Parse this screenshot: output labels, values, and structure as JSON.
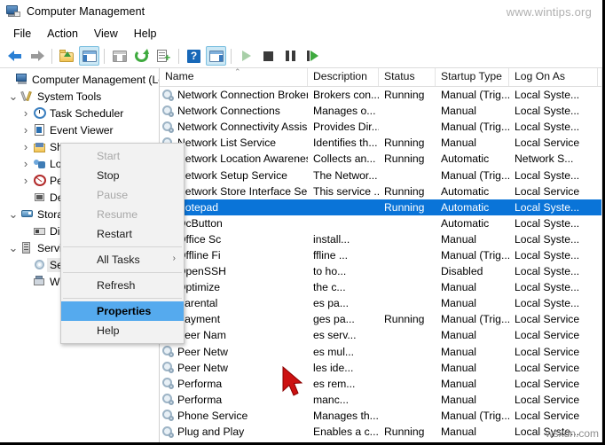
{
  "window": {
    "title": "Computer Management",
    "icon": "computer-management-icon"
  },
  "menubar": {
    "items": [
      {
        "label": "File"
      },
      {
        "label": "Action"
      },
      {
        "label": "View"
      },
      {
        "label": "Help"
      }
    ]
  },
  "toolbar": {
    "buttons": [
      {
        "name": "back-arrow-icon",
        "label": "Back"
      },
      {
        "name": "forward-arrow-icon",
        "label": "Forward"
      },
      {
        "name": "up-one-level-icon",
        "label": "Up One Level"
      },
      {
        "name": "show-hide-console-tree-icon",
        "label": "Show/Hide Console Tree"
      },
      {
        "name": "properties-icon",
        "label": "Properties"
      },
      {
        "name": "refresh-icon",
        "label": "Refresh"
      },
      {
        "name": "export-list-icon",
        "label": "Export List"
      },
      {
        "name": "help-icon",
        "label": "Help"
      },
      {
        "name": "show-hide-action-pane-icon",
        "label": "Show/Hide Action Pane"
      },
      {
        "name": "start-service-icon",
        "label": "Start Service"
      },
      {
        "name": "stop-service-icon",
        "label": "Stop Service"
      },
      {
        "name": "pause-service-icon",
        "label": "Pause Service"
      },
      {
        "name": "restart-service-icon",
        "label": "Restart Service"
      }
    ]
  },
  "tree": {
    "nodes": [
      {
        "label": "Computer Management (Local",
        "depth": 0,
        "chev": "",
        "icon": "computer",
        "selected": false
      },
      {
        "label": "System Tools",
        "depth": 1,
        "chev": "v",
        "icon": "tools",
        "selected": false
      },
      {
        "label": "Task Scheduler",
        "depth": 2,
        "chev": ">",
        "icon": "clock",
        "selected": false
      },
      {
        "label": "Event Viewer",
        "depth": 2,
        "chev": ">",
        "icon": "log",
        "selected": false
      },
      {
        "label": "Shared Folders",
        "depth": 2,
        "chev": ">",
        "icon": "folder",
        "selected": false
      },
      {
        "label": "Local Users and Groups",
        "depth": 2,
        "chev": ">",
        "icon": "users",
        "selected": false
      },
      {
        "label": "Performance",
        "depth": 2,
        "chev": ">",
        "icon": "perf",
        "selected": false
      },
      {
        "label": "Device Manager",
        "depth": 2,
        "chev": "",
        "icon": "device",
        "selected": false
      },
      {
        "label": "Storage",
        "depth": 1,
        "chev": "v",
        "icon": "storage",
        "selected": false
      },
      {
        "label": "Disk Management",
        "depth": 2,
        "chev": "",
        "icon": "disk",
        "selected": false
      },
      {
        "label": "Services and Applications",
        "depth": 1,
        "chev": "v",
        "icon": "apps",
        "selected": false
      },
      {
        "label": "Services",
        "depth": 2,
        "chev": "",
        "icon": "gear",
        "selected": true
      },
      {
        "label": "WMI Control",
        "depth": 2,
        "chev": "",
        "icon": "wmi",
        "selected": false
      }
    ]
  },
  "list": {
    "columns": [
      {
        "label": "Name",
        "key": "name"
      },
      {
        "label": "Description",
        "key": "description"
      },
      {
        "label": "Status",
        "key": "status"
      },
      {
        "label": "Startup Type",
        "key": "startup"
      },
      {
        "label": "Log On As",
        "key": "logon"
      }
    ],
    "sort_column": "Name",
    "sort_direction": "ascending",
    "rows": [
      {
        "name": "Network Connection Broker",
        "description": "Brokers con...",
        "status": "Running",
        "startup": "Manual (Trig...",
        "logon": "Local Syste...",
        "selected": false
      },
      {
        "name": "Network Connections",
        "description": "Manages o...",
        "status": "",
        "startup": "Manual",
        "logon": "Local Syste...",
        "selected": false
      },
      {
        "name": "Network Connectivity Assis...",
        "description": "Provides Dir...",
        "status": "",
        "startup": "Manual (Trig...",
        "logon": "Local Syste...",
        "selected": false
      },
      {
        "name": "Network List Service",
        "description": "Identifies th...",
        "status": "Running",
        "startup": "Manual",
        "logon": "Local Service",
        "selected": false
      },
      {
        "name": "Network Location Awareness",
        "description": "Collects an...",
        "status": "Running",
        "startup": "Automatic",
        "logon": "Network S...",
        "selected": false
      },
      {
        "name": "Network Setup Service",
        "description": "The Networ...",
        "status": "",
        "startup": "Manual (Trig...",
        "logon": "Local Syste...",
        "selected": false
      },
      {
        "name": "Network Store Interface Ser...",
        "description": "This service ...",
        "status": "Running",
        "startup": "Automatic",
        "logon": "Local Service",
        "selected": false
      },
      {
        "name": "Notepad",
        "description": "",
        "status": "Running",
        "startup": "Automatic",
        "logon": "Local Syste...",
        "selected": true
      },
      {
        "name": "OcButton",
        "description": "",
        "status": "",
        "startup": "Automatic",
        "logon": "Local Syste...",
        "selected": false
      },
      {
        "name": "Office  Sc",
        "description": "install...",
        "status": "",
        "startup": "Manual",
        "logon": "Local Syste...",
        "selected": false
      },
      {
        "name": "Offline Fi",
        "description": "ffline ...",
        "status": "",
        "startup": "Manual (Trig...",
        "logon": "Local Syste...",
        "selected": false
      },
      {
        "name": "OpenSSH",
        "description": "to ho...",
        "status": "",
        "startup": "Disabled",
        "logon": "Local Syste...",
        "selected": false
      },
      {
        "name": "Optimize",
        "description": "the c...",
        "status": "",
        "startup": "Manual",
        "logon": "Local Syste...",
        "selected": false
      },
      {
        "name": "Parental",
        "description": "es pa...",
        "status": "",
        "startup": "Manual",
        "logon": "Local Syste...",
        "selected": false
      },
      {
        "name": "Payment",
        "description": "ges pa...",
        "status": "Running",
        "startup": "Manual (Trig...",
        "logon": "Local Service",
        "selected": false
      },
      {
        "name": "Peer Nam",
        "description": "es serv...",
        "status": "",
        "startup": "Manual",
        "logon": "Local Service",
        "selected": false
      },
      {
        "name": "Peer Netw",
        "description": "es mul...",
        "status": "",
        "startup": "Manual",
        "logon": "Local Service",
        "selected": false
      },
      {
        "name": "Peer Netw",
        "description": "les ide...",
        "status": "",
        "startup": "Manual",
        "logon": "Local Service",
        "selected": false
      },
      {
        "name": "Performa",
        "description": "es rem...",
        "status": "",
        "startup": "Manual",
        "logon": "Local Service",
        "selected": false
      },
      {
        "name": "Performa",
        "description": "manc...",
        "status": "",
        "startup": "Manual",
        "logon": "Local Service",
        "selected": false
      },
      {
        "name": "Phone Service",
        "description": "Manages th...",
        "status": "",
        "startup": "Manual (Trig...",
        "logon": "Local Service",
        "selected": false
      },
      {
        "name": "Plug and Play",
        "description": "Enables a c...",
        "status": "Running",
        "startup": "Manual",
        "logon": "Local Syste...",
        "selected": false
      }
    ]
  },
  "context_menu": {
    "items": [
      {
        "label": "Start",
        "state": "disabled",
        "submenu": false
      },
      {
        "label": "Stop",
        "state": "enabled",
        "submenu": false
      },
      {
        "label": "Pause",
        "state": "disabled",
        "submenu": false
      },
      {
        "label": "Resume",
        "state": "disabled",
        "submenu": false
      },
      {
        "label": "Restart",
        "state": "enabled",
        "submenu": false
      },
      {
        "label": "__sep__",
        "state": "separator",
        "submenu": false
      },
      {
        "label": "All Tasks",
        "state": "enabled",
        "submenu": true,
        "submenu_glyph": "›"
      },
      {
        "label": "__sep__",
        "state": "separator",
        "submenu": false
      },
      {
        "label": "Refresh",
        "state": "enabled",
        "submenu": false
      },
      {
        "label": "__sep__",
        "state": "separator",
        "submenu": false
      },
      {
        "label": "Properties",
        "state": "highlighted",
        "submenu": false
      },
      {
        "label": "Help",
        "state": "enabled",
        "submenu": false
      }
    ]
  },
  "cursor": {
    "name": "mouse-pointer",
    "color": "#cc1111"
  },
  "watermarks": {
    "top_right": "www.wintips.org",
    "bottom_right": "wsxdn.com"
  },
  "colors": {
    "selection_blue": "#0a74d8",
    "menu_highlight": "#55aaee",
    "toolbar_pressed": "#cce8f5"
  }
}
